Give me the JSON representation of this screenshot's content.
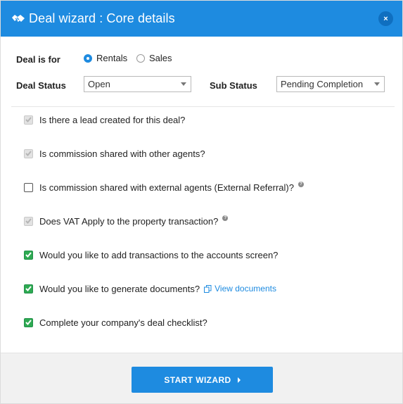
{
  "header": {
    "title": "Deal wizard : Core details",
    "icon": "handshake-icon",
    "close_label": "×"
  },
  "deal_for": {
    "label": "Deal is for",
    "options": [
      {
        "label": "Rentals",
        "selected": true
      },
      {
        "label": "Sales",
        "selected": false
      }
    ]
  },
  "deal_status": {
    "label": "Deal Status",
    "value": "Open"
  },
  "sub_status": {
    "label": "Sub Status",
    "value": "Pending Completion"
  },
  "questions": [
    {
      "text": "Is there a lead created for this deal?",
      "state": "checked-disabled"
    },
    {
      "text": "Is commission shared with other agents?",
      "state": "checked-disabled"
    },
    {
      "text": "Is commission shared with external agents (External Referral)?",
      "state": "unchecked",
      "help": true
    },
    {
      "text": "Does VAT Apply to the property transaction?",
      "state": "checked-disabled",
      "help": true
    },
    {
      "text": "Would you like to add transactions to the accounts screen?",
      "state": "checked"
    },
    {
      "text": "Would you like to generate documents?",
      "state": "checked",
      "link": "View documents"
    },
    {
      "text": "Complete your company's deal checklist?",
      "state": "checked"
    }
  ],
  "footer": {
    "start_label": "START WIZARD"
  },
  "colors": {
    "primary": "#1e8be0",
    "checked_green": "#2eaa52",
    "disabled_gray": "#e2e2e2"
  }
}
